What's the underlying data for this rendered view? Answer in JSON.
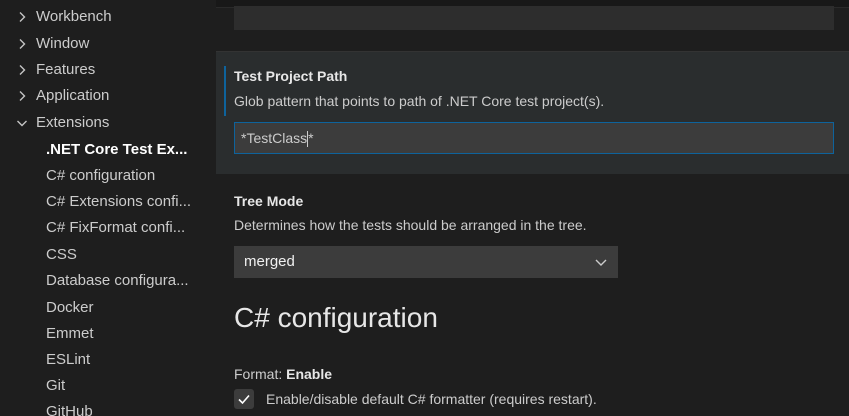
{
  "toc": {
    "groups": [
      {
        "label": "Workbench",
        "expanded": false
      },
      {
        "label": "Window",
        "expanded": false
      },
      {
        "label": "Features",
        "expanded": false
      },
      {
        "label": "Application",
        "expanded": false
      },
      {
        "label": "Extensions",
        "expanded": true
      }
    ],
    "extensions": [
      {
        "label": ".NET Core Test Ex...",
        "active": true
      },
      {
        "label": "C# configuration"
      },
      {
        "label": "C# Extensions confi..."
      },
      {
        "label": "C# FixFormat confi..."
      },
      {
        "label": "CSS"
      },
      {
        "label": "Database configura..."
      },
      {
        "label": "Docker"
      },
      {
        "label": "Emmet"
      },
      {
        "label": "ESLint"
      },
      {
        "label": "Git"
      },
      {
        "label": "GitHub"
      }
    ]
  },
  "settings": {
    "test_project_path": {
      "title": "Test Project Path",
      "description": "Glob pattern that points to path of .NET Core test project(s).",
      "value_before_caret": "*TestClass",
      "value_after_caret": "*"
    },
    "tree_mode": {
      "title": "Tree Mode",
      "description": "Determines how the tests should be arranged in the tree.",
      "selected": "merged"
    },
    "section_heading": "C# configuration",
    "format_enable": {
      "category": "Format: ",
      "title": "Enable",
      "description": "Enable/disable default C# formatter (requires restart).",
      "checked": true
    }
  },
  "colors": {
    "accent_border": "#0e639c",
    "background": "#1e1e1e"
  }
}
